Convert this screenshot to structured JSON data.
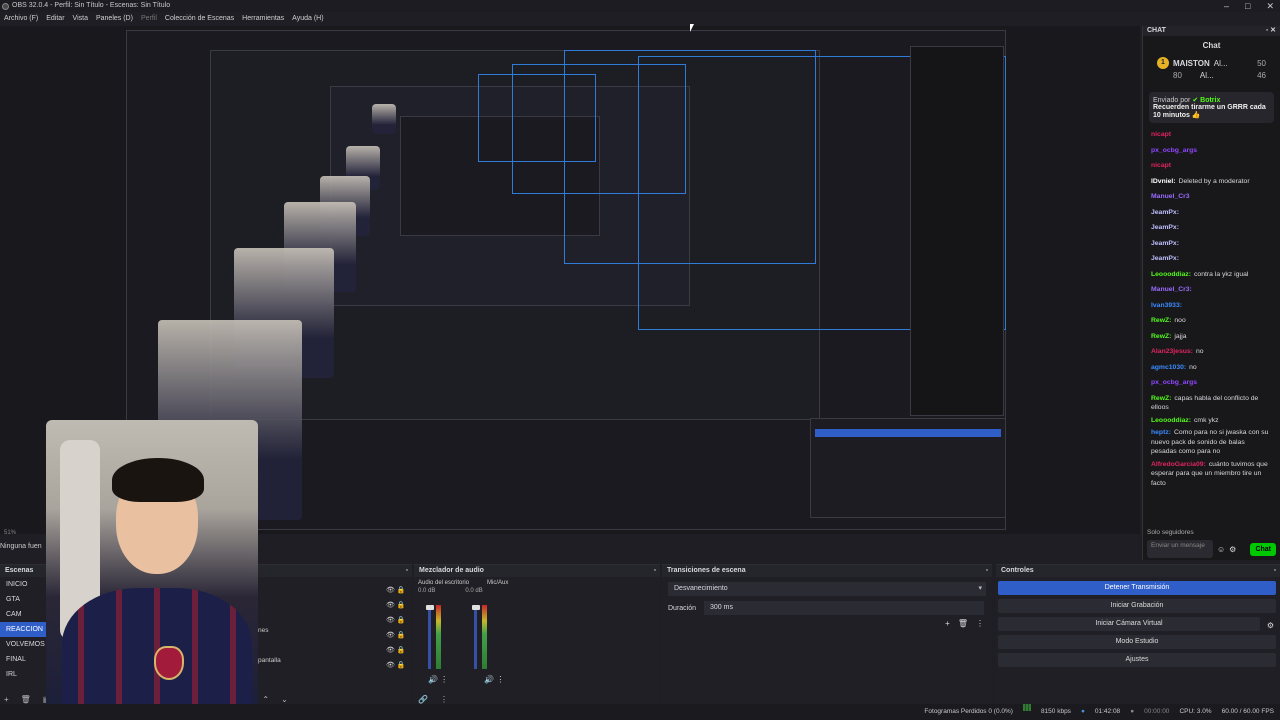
{
  "window": {
    "title": "OBS 32.0.4 - Perfil: Sin Título - Escenas: Sin Título"
  },
  "menu": [
    "Archivo (F)",
    "Editar",
    "Vista",
    "Paneles (D)",
    "Perfil",
    "Colección de Escenas",
    "Herramientas",
    "Ayuda (H)"
  ],
  "chat": {
    "dock_label": "CHAT",
    "title": "Chat",
    "leaderboard": [
      {
        "name": "MAISTON",
        "points": "80"
      },
      {
        "name": "Al...",
        "points": "50"
      },
      {
        "name": "Al...",
        "points": "46"
      }
    ],
    "pinned": {
      "sender_prefix": "Enviado por",
      "sender": "Botrix",
      "text": "Recuerden tirarme un GRRR cada 10 minutos 👍"
    },
    "messages": [
      {
        "user": "nicapt",
        "text": "",
        "color": "#e0245e"
      },
      {
        "user": "px_ocbg_args",
        "text": "",
        "color": "#9146ff"
      },
      {
        "user": "nicapt",
        "text": "",
        "color": "#e0245e"
      },
      {
        "user": "IDvniel:",
        "text": "Deleted by a moderator",
        "color": "#ffffff"
      },
      {
        "user": "Manuel_Cr3",
        "text": "",
        "color": "#9a6bff"
      },
      {
        "user": "JeamPx:",
        "text": "",
        "color": "#bfbfff"
      },
      {
        "user": "JeamPx:",
        "text": "",
        "color": "#bfbfff"
      },
      {
        "user": "JeamPx:",
        "text": "",
        "color": "#bfbfff"
      },
      {
        "user": "JeamPx:",
        "text": "",
        "color": "#bfbfff"
      },
      {
        "user": "Leoooddiaz:",
        "text": "contra la ykz igual",
        "color": "#53fc18"
      },
      {
        "user": "Manuel_Cr3:",
        "text": "",
        "color": "#9a6bff"
      },
      {
        "user": "Ivan3933:",
        "text": "",
        "color": "#3a8bff"
      },
      {
        "user": "RewZ:",
        "text": "noo",
        "color": "#53fc18"
      },
      {
        "user": "RewZ:",
        "text": "jajja",
        "color": "#53fc18"
      },
      {
        "user": "Alan23jesus:",
        "text": "no",
        "color": "#e0245e"
      },
      {
        "user": "agmc1030:",
        "text": "no",
        "color": "#3a8bff"
      },
      {
        "user": "px_ocbg_args",
        "text": "",
        "color": "#9146ff"
      },
      {
        "user": "RewZ:",
        "text": "capas habla del conflicto de elloos",
        "color": "#53fc18"
      },
      {
        "user": "Leoooddiaz:",
        "text": "cmk ykz",
        "color": "#53fc18"
      },
      {
        "user": "heptz:",
        "text": "Como para no si jwaska con su nuevo pack de sonido de balas pesadas como para no",
        "color": "#3a8bff"
      },
      {
        "user": "AlfredoGarcia09:",
        "text": "cuánto tuvimos que esperar para que un miembro tire un facto",
        "color": "#e0245e"
      }
    ],
    "followers_only": "Solo seguidores",
    "input_placeholder": "Enviar un mensaje",
    "send_button": "Chat"
  },
  "preview": {
    "zoom": "51%",
    "scene_label": "Ninguna fuen"
  },
  "scenes": {
    "title": "Escenas",
    "items": [
      "INICIO",
      "GTA",
      "CAM",
      "REACCION",
      "VOLVEMOS",
      "FINAL",
      "IRL"
    ],
    "active": "REACCION",
    "source_fragments": [
      "nes",
      "pantalla"
    ]
  },
  "mixer": {
    "title": "Mezclador de audio",
    "channels": [
      {
        "name": "Audio del escritorio",
        "db": "0.0 dB"
      },
      {
        "name": "Mic/Aux",
        "db": "0.0 dB"
      }
    ]
  },
  "transitions": {
    "title": "Transiciones de escena",
    "selected": "Desvanecimiento",
    "duration_label": "Duración",
    "duration_value": "300 ms"
  },
  "controls": {
    "title": "Controles",
    "buttons": [
      "Detener Transmisión",
      "Iniciar Grabación",
      "Iniciar Cámara Virtual",
      "Modo Estudio",
      "Ajustes"
    ]
  },
  "status": {
    "dropped": "Fotogramas Perdidos 0 (0.0%)",
    "bitrate": "8150 kbps",
    "time": "01:42:08",
    "rec": "00:00:00",
    "cpu": "CPU: 3.0%",
    "fps": "60.00 / 60.00 FPS"
  },
  "colors": {
    "accent": "#2f5ec9",
    "selection": "#2f7bd8",
    "chat_green": "#00c800"
  }
}
